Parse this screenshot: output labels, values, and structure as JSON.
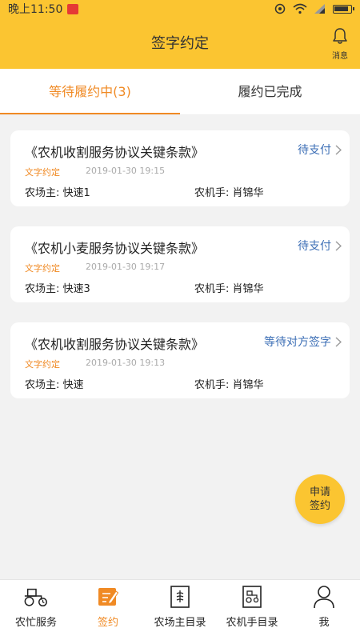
{
  "status_bar": {
    "time": "晚上11:50"
  },
  "header": {
    "title": "签字约定",
    "message_label": "消息"
  },
  "tabs": [
    {
      "label": "等待履约中(3)",
      "active": true
    },
    {
      "label": "履约已完成",
      "active": false
    }
  ],
  "cards": [
    {
      "title": "《农机收割服务协议关键条款》",
      "status": "待支付",
      "tag": "文字约定",
      "date": "2019-01-30 19:15",
      "farmer": "农场主: 快速1",
      "operator": "农机手: 肖锦华"
    },
    {
      "title": "《农机小麦服务协议关键条款》",
      "status": "待支付",
      "tag": "文字约定",
      "date": "2019-01-30 19:17",
      "farmer": "农场主: 快速3",
      "operator": "农机手: 肖锦华"
    },
    {
      "title": "《农机收割服务协议关键条款》",
      "status": "等待对方签字",
      "tag": "文字约定",
      "date": "2019-01-30 19:13",
      "farmer": "农场主: 快速",
      "operator": "农机手: 肖锦华"
    }
  ],
  "fab": {
    "line1": "申请",
    "line2": "签约"
  },
  "bottom_nav": [
    {
      "label": "农忙服务",
      "icon": "tractor-icon",
      "active": false
    },
    {
      "label": "签约",
      "icon": "sign-icon",
      "active": true
    },
    {
      "label": "农场主目录",
      "icon": "farmer-directory-icon",
      "active": false
    },
    {
      "label": "农机手目录",
      "icon": "operator-directory-icon",
      "active": false
    },
    {
      "label": "我",
      "icon": "person-icon",
      "active": false
    }
  ],
  "colors": {
    "primary": "#fbc531",
    "accent": "#f08a24",
    "status_link": "#3d6fb6"
  }
}
